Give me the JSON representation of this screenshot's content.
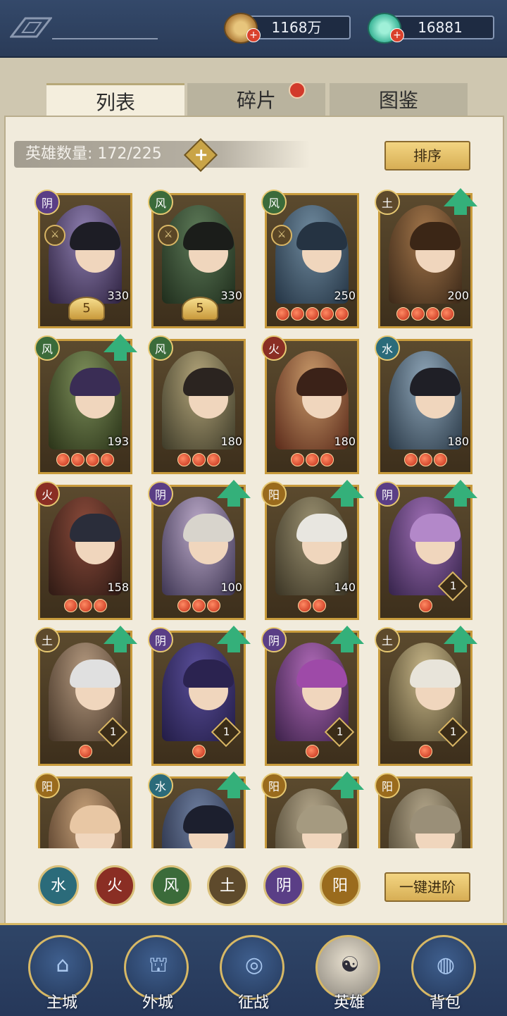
{
  "currency": {
    "coins": "1168万",
    "jade": "16881"
  },
  "tabs": [
    "列表",
    "碎片",
    "图鉴"
  ],
  "hero_count": "英雄数量: 172/225",
  "buttons": {
    "sort": "排序",
    "advance": "一键进阶"
  },
  "elements": [
    "水",
    "火",
    "风",
    "土",
    "阴",
    "阳"
  ],
  "element_colors": {
    "水": "#2b6b7a",
    "火": "#8a2e24",
    "风": "#3b6b3a",
    "土": "#5e4a2c",
    "阴": "#5a3e86",
    "阳": "#9a6b1d"
  },
  "heroes": [
    {
      "element": "阴",
      "level": "330",
      "stars": 0,
      "badge": "5",
      "weapon": true,
      "upgrade": false
    },
    {
      "element": "风",
      "level": "330",
      "stars": 0,
      "badge": "5",
      "weapon": true,
      "upgrade": false
    },
    {
      "element": "风",
      "level": "250",
      "stars": 5,
      "badge": "",
      "weapon": true,
      "upgrade": false
    },
    {
      "element": "土",
      "level": "200",
      "stars": 4,
      "badge": "",
      "weapon": false,
      "upgrade": true
    },
    {
      "element": "风",
      "level": "193",
      "stars": 4,
      "badge": "",
      "weapon": false,
      "upgrade": true
    },
    {
      "element": "风",
      "level": "180",
      "stars": 3,
      "badge": "",
      "weapon": false,
      "upgrade": false
    },
    {
      "element": "火",
      "level": "180",
      "stars": 3,
      "badge": "",
      "weapon": false,
      "upgrade": false
    },
    {
      "element": "水",
      "level": "180",
      "stars": 3,
      "badge": "",
      "weapon": false,
      "upgrade": false
    },
    {
      "element": "火",
      "level": "158",
      "stars": 3,
      "badge": "",
      "weapon": false,
      "upgrade": false
    },
    {
      "element": "阴",
      "level": "100",
      "stars": 3,
      "badge": "",
      "weapon": false,
      "upgrade": true
    },
    {
      "element": "阳",
      "level": "140",
      "stars": 2,
      "badge": "",
      "weapon": false,
      "upgrade": true
    },
    {
      "element": "阴",
      "level": "1",
      "stars": 1,
      "badge": "",
      "weapon": false,
      "upgrade": true,
      "boxed": true
    },
    {
      "element": "土",
      "level": "1",
      "stars": 1,
      "badge": "",
      "weapon": false,
      "upgrade": true,
      "boxed": true
    },
    {
      "element": "阴",
      "level": "1",
      "stars": 1,
      "badge": "",
      "weapon": false,
      "upgrade": true,
      "boxed": true
    },
    {
      "element": "阴",
      "level": "1",
      "stars": 1,
      "badge": "",
      "weapon": false,
      "upgrade": true,
      "boxed": true
    },
    {
      "element": "土",
      "level": "1",
      "stars": 1,
      "badge": "",
      "weapon": false,
      "upgrade": true,
      "boxed": true
    },
    {
      "element": "阳",
      "level": "",
      "stars": 0,
      "badge": "",
      "weapon": false,
      "upgrade": false
    },
    {
      "element": "水",
      "level": "",
      "stars": 0,
      "badge": "",
      "weapon": false,
      "upgrade": true
    },
    {
      "element": "阳",
      "level": "",
      "stars": 0,
      "badge": "",
      "weapon": false,
      "upgrade": true
    },
    {
      "element": "阳",
      "level": "",
      "stars": 0,
      "badge": "",
      "weapon": false,
      "upgrade": false
    }
  ],
  "nav": [
    {
      "label": "主城",
      "icon": "castle-icon"
    },
    {
      "label": "外城",
      "icon": "gate-icon"
    },
    {
      "label": "征战",
      "icon": "battle-icon"
    },
    {
      "label": "英雄",
      "icon": "hero-icon",
      "active": true
    },
    {
      "label": "背包",
      "icon": "bag-icon"
    }
  ]
}
